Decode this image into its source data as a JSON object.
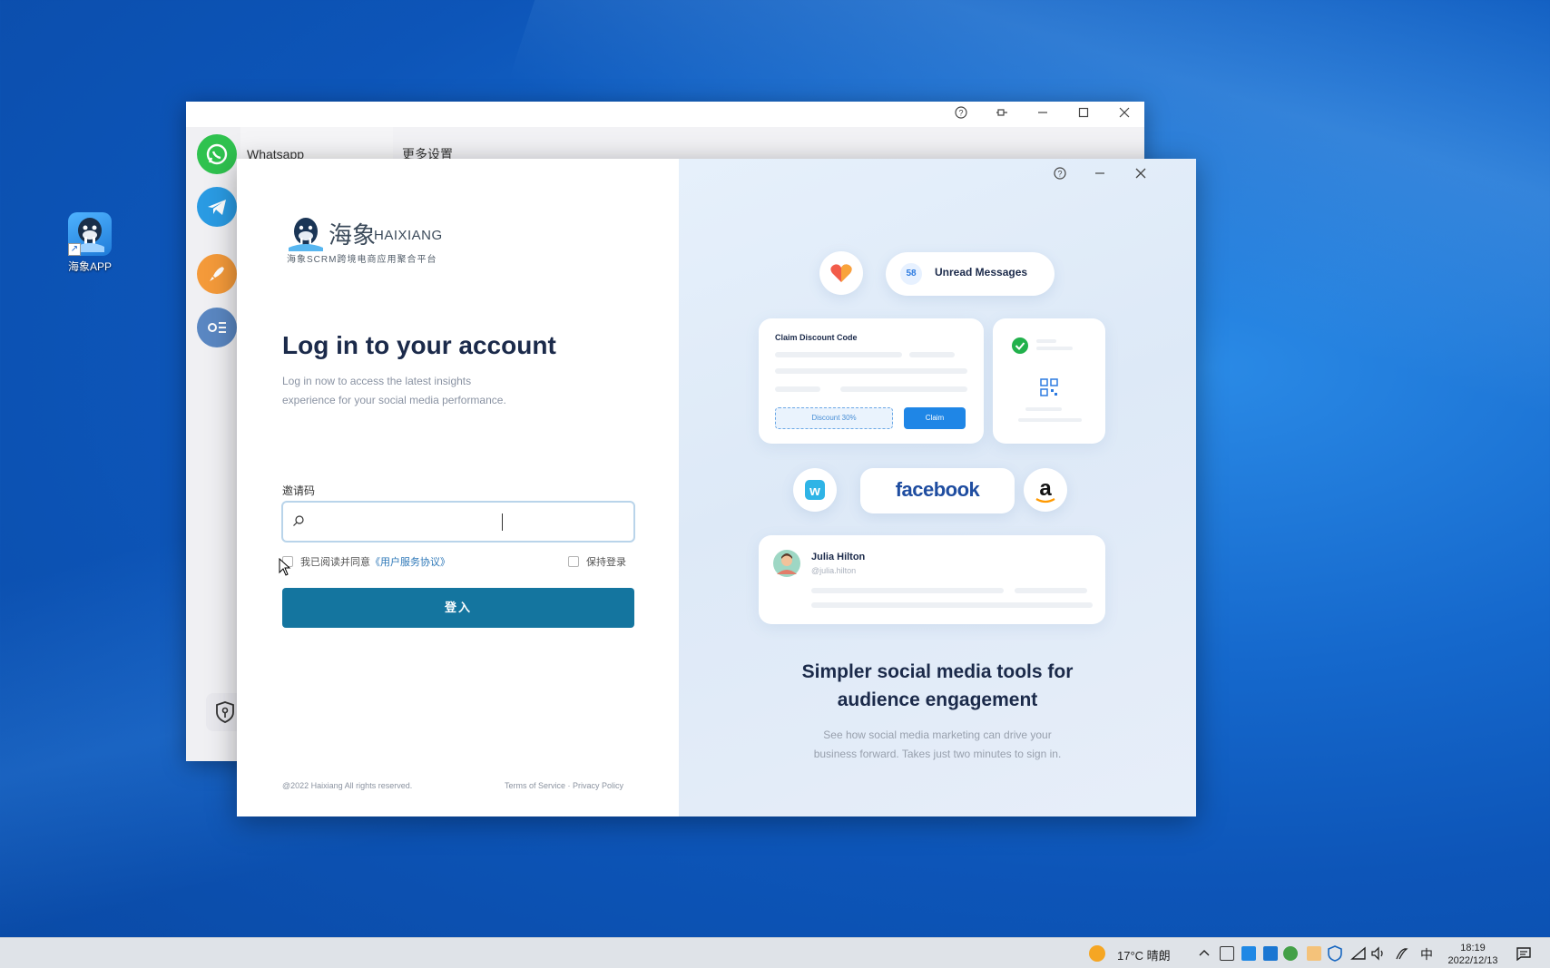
{
  "desktop": {
    "icon_label": "海象APP"
  },
  "background_window": {
    "sidebar_app_label": "Whatsapp",
    "content_title": "更多设置"
  },
  "login": {
    "logo_cn": "海象",
    "logo_en": "HAIXIANG",
    "logo_tagline": "海象SCRM跨境电商应用聚合平台",
    "heading": "Log in to your account",
    "subtitle_line1": "Log in now to access the latest insights",
    "subtitle_line2": "experience for your social media performance.",
    "field_label": "邀请码",
    "field_value": "",
    "field_placeholder": "",
    "agree_text": "我已阅读并同意",
    "agree_link": "《用户服务协议》",
    "agree_checked": false,
    "keep_login_label": "保持登录",
    "keep_login_checked": false,
    "login_button": "登入",
    "footer_copyright": "@2022 Haixiang All rights reserved.",
    "footer_links": "Terms of Service · Privacy Policy"
  },
  "promo": {
    "unread_count": "58",
    "unread_label": "Unread Messages",
    "claim_title": "Claim Discount Code",
    "discount_label": "Discount 30%",
    "claim_button": "Claim",
    "facebook_label": "facebook",
    "amazon_label": "a",
    "wish_label": "w",
    "user_name": "Julia Hilton",
    "user_handle": "@julia.hilton",
    "title_line1": "Simpler social media tools for",
    "title_line2": "audience engagement",
    "sub_line1": "See how social media marketing can drive your",
    "sub_line2": "business forward. Takes just two minutes to sign in."
  },
  "taskbar": {
    "weather": "17°C  晴朗",
    "ime": "中",
    "time": "18:19",
    "date": "2022/12/13"
  },
  "colors": {
    "primary_button": "#14759f",
    "heading": "#1b2a4a",
    "link": "#2e78b8",
    "desktop_blue": "#1568cc"
  }
}
